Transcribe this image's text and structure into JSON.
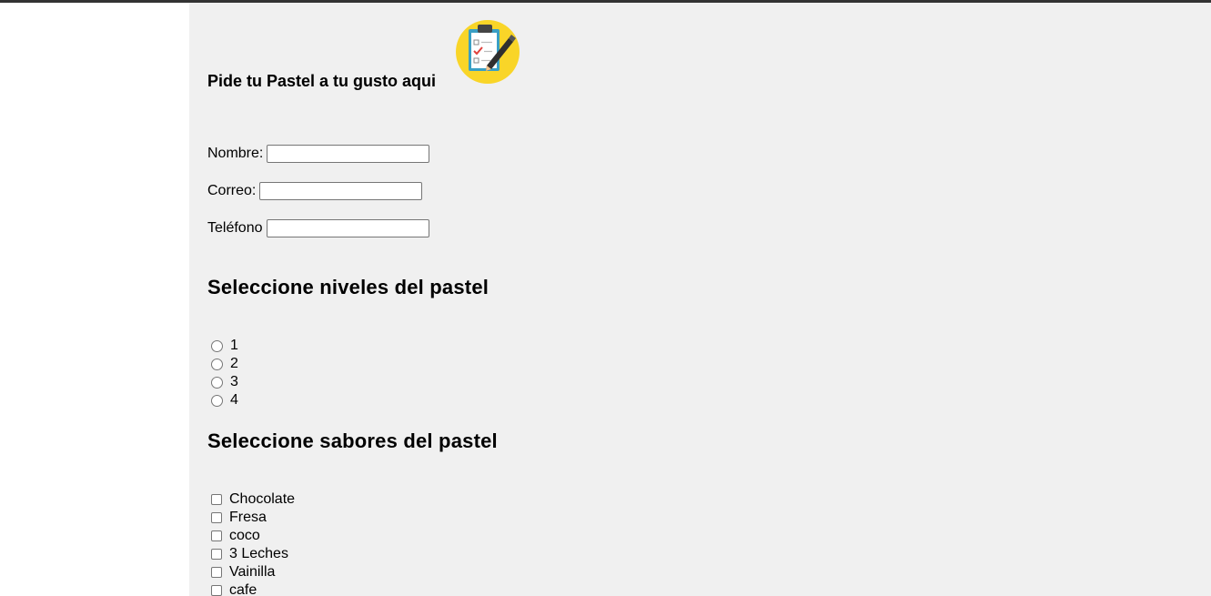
{
  "header": {
    "title": "Pide tu Pastel a tu gusto aqui",
    "logo_icon": "clipboard-checklist-icon"
  },
  "form": {
    "fields": [
      {
        "label": "Nombre:",
        "value": ""
      },
      {
        "label": "Correo:",
        "value": ""
      },
      {
        "label": "Teléfono",
        "value": ""
      }
    ]
  },
  "niveles": {
    "heading": "Seleccione niveles del pastel",
    "options": [
      "1",
      "2",
      "3",
      "4"
    ]
  },
  "sabores": {
    "heading": "Seleccione sabores del pastel",
    "options": [
      "Chocolate",
      "Fresa",
      "coco",
      "3 Leches",
      "Vainilla",
      "cafe"
    ]
  },
  "colors": {
    "content_background": "#f0f0f0",
    "logo_yellow": "#f9d528",
    "top_bar": "#333333"
  }
}
